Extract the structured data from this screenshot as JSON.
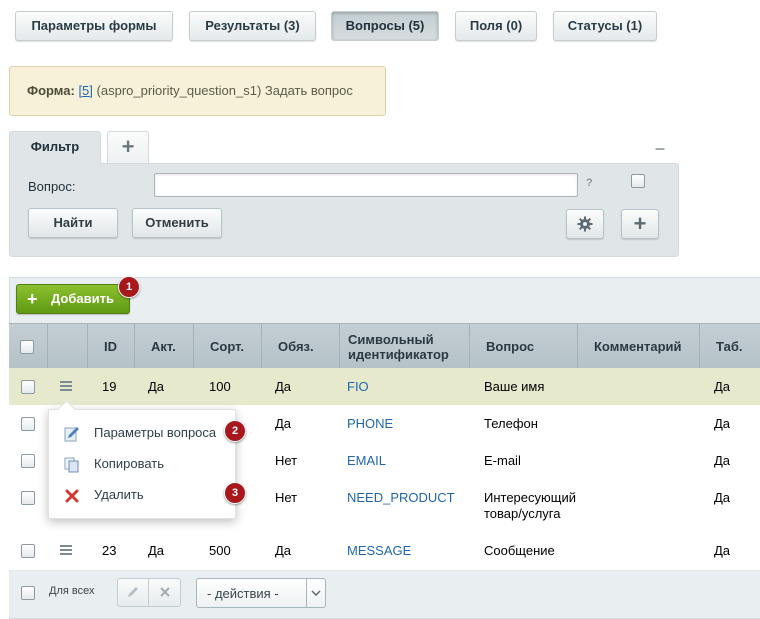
{
  "tabs": [
    {
      "label": "Параметры формы",
      "active": false
    },
    {
      "label": "Результаты (3)",
      "active": false
    },
    {
      "label": "Вопросы (5)",
      "active": true
    },
    {
      "label": "Поля (0)",
      "active": false
    },
    {
      "label": "Статусы (1)",
      "active": false
    }
  ],
  "info": {
    "label": "Форма:",
    "form_id": "[5]",
    "text": "(aspro_priority_question_s1) Задать вопрос"
  },
  "filter": {
    "tab_label": "Фильтр",
    "add_tab_symbol": "+",
    "collapse_symbol": "–",
    "field_label": "Вопрос:",
    "field_value": "",
    "help_symbol": "?",
    "find_label": "Найти",
    "cancel_label": "Отменить",
    "settings_icon": "gear-icon",
    "plus_symbol": "+"
  },
  "list": {
    "add_label": "Добавить",
    "add_symbol": "+",
    "badges": [
      "1",
      "2",
      "3"
    ],
    "columns": [
      "ID",
      "Акт.",
      "Сорт.",
      "Обяз.",
      "Символьный идентификатор",
      "Вопрос",
      "Комментарий",
      "Таб."
    ],
    "rows": [
      {
        "id": "19",
        "active": "Да",
        "sort": "100",
        "required": "Да",
        "code": "FIO",
        "question": "Ваше имя",
        "tab": "Да"
      },
      {
        "id": "",
        "active": "",
        "sort": "",
        "required": "Да",
        "code": "PHONE",
        "question": "Телефон",
        "tab": "Да"
      },
      {
        "id": "",
        "active": "",
        "sort": "",
        "required": "Нет",
        "code": "EMAIL",
        "question": "E-mail",
        "tab": "Да"
      },
      {
        "id": "",
        "active": "",
        "sort": "",
        "required": "Нет",
        "code": "NEED_PRODUCT",
        "question": "Интересующий товар/услуга",
        "tab": "Да"
      },
      {
        "id": "23",
        "active": "Да",
        "sort": "500",
        "required": "Да",
        "code": "MESSAGE",
        "question": "Сообщение",
        "tab": "Да"
      }
    ],
    "menu": [
      {
        "label": "Параметры вопроса",
        "icon": "edit-icon"
      },
      {
        "label": "Копировать",
        "icon": "copy-icon"
      },
      {
        "label": "Удалить",
        "icon": "delete-icon"
      }
    ]
  },
  "footer": {
    "for_all_label": "Для всех",
    "actions_placeholder": "- действия -",
    "edit_icon": "pencil-icon",
    "delete_icon": "cross-icon"
  }
}
